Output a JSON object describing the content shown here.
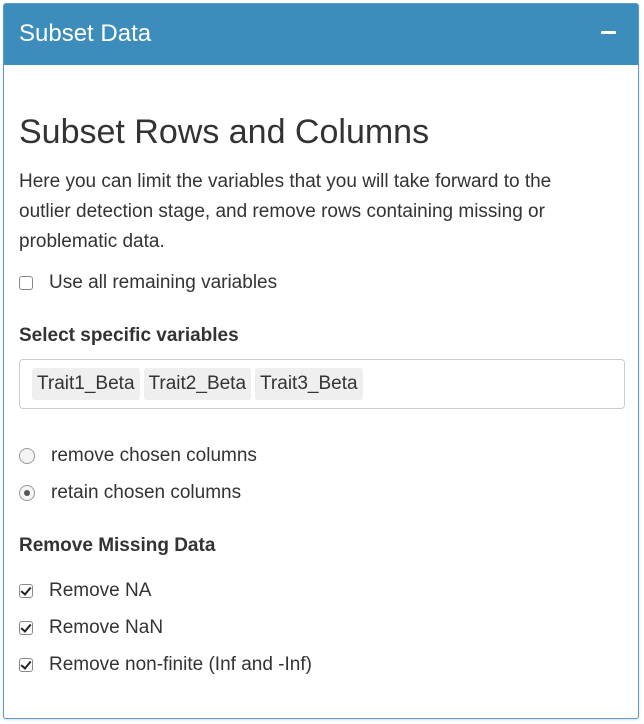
{
  "panel": {
    "title": "Subset Data",
    "header_color": "#3c8dbc"
  },
  "section": {
    "title": "Subset Rows and Columns",
    "description": "Here you can limit the variables that you will take forward to the outlier detection stage, and remove rows containing missing or problematic data."
  },
  "use_all": {
    "label": "Use all remaining variables",
    "checked": false
  },
  "variables": {
    "label": "Select specific variables",
    "selected": [
      "Trait1_Beta",
      "Trait2_Beta",
      "Trait3_Beta"
    ]
  },
  "column_mode": {
    "options": [
      {
        "label": "remove chosen columns",
        "selected": false
      },
      {
        "label": "retain chosen columns",
        "selected": true
      }
    ]
  },
  "missing": {
    "label": "Remove Missing Data",
    "options": [
      {
        "label": "Remove NA",
        "checked": true
      },
      {
        "label": "Remove NaN",
        "checked": true
      },
      {
        "label": "Remove non-finite (Inf and -Inf)",
        "checked": true
      }
    ]
  }
}
